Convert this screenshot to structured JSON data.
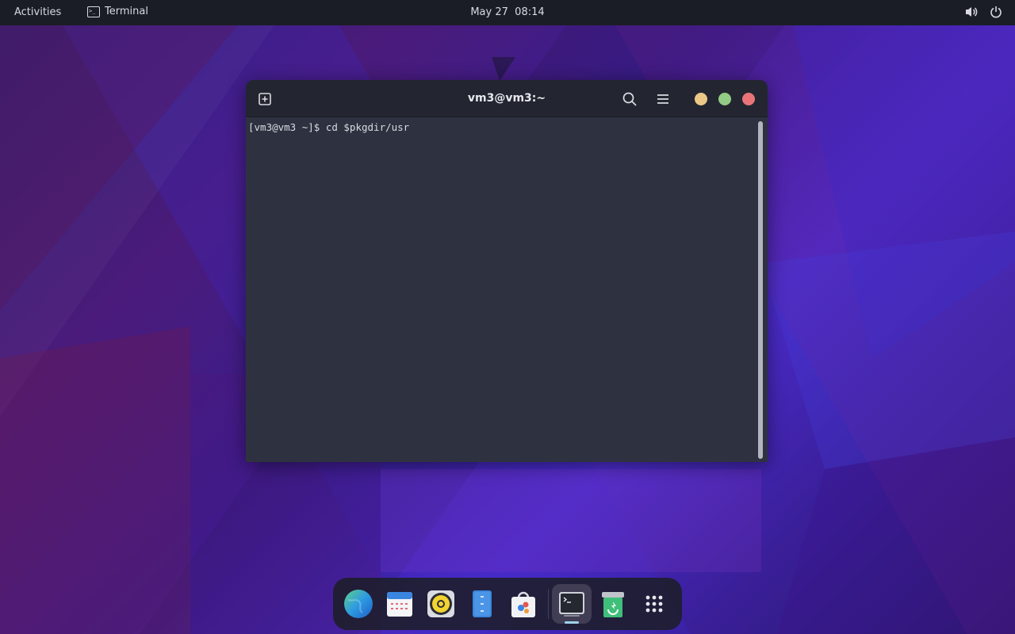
{
  "topbar": {
    "activities_label": "Activities",
    "app_menu_label": "Terminal",
    "clock_date": "May 27",
    "clock_time": "08:14"
  },
  "terminal": {
    "title": "vm3@vm3:~",
    "lines": [
      "[vm3@vm3 ~]$ cd $pkgdir/usr"
    ]
  },
  "window_buttons": {
    "minimize_color": "#ebc887",
    "maximize_color": "#93cc84",
    "close_color": "#e97478"
  },
  "dock": {
    "items": [
      "web-browser-icon",
      "calendar-icon",
      "rhythmbox-icon",
      "file-manager-icon",
      "software-store-icon",
      "terminal-icon",
      "trash-icon",
      "app-grid-icon"
    ]
  }
}
